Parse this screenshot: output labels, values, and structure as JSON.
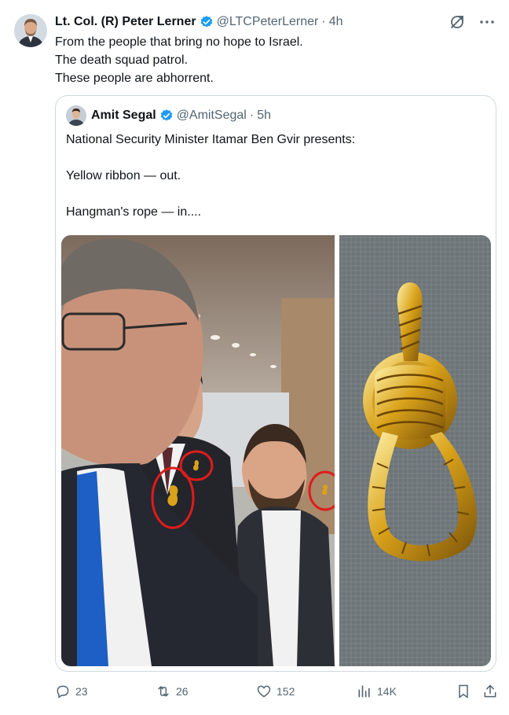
{
  "tweet": {
    "author_name": "Lt. Col. (R) Peter Lerner",
    "handle": "@LTCPeterLerner",
    "separator": "·",
    "time": "4h",
    "lines": [
      "From the people that bring no hope to Israel.",
      "The death squad patrol.",
      "These people are abhorrent."
    ]
  },
  "quote": {
    "author_name": "Amit Segal",
    "handle": "@AmitSegal",
    "separator": "·",
    "time": "5h",
    "paragraphs": [
      "National Security Minister Itamar Ben Gvir presents:",
      "Yellow ribbon — out.",
      "Hangman's rope — in...."
    ]
  },
  "actions": {
    "replies": "23",
    "reposts": "26",
    "likes": "152",
    "views": "14K"
  },
  "colors": {
    "verified": "#1d9bf0",
    "secondary_text": "#536471",
    "border": "#cfd9de",
    "tie_blue": "#1d5fc4",
    "pin_gold": "#d9a21a",
    "circle_red": "#e01b1b"
  },
  "icons": [
    "verified-badge-icon",
    "grok-icon",
    "more-icon",
    "reply-icon",
    "repost-icon",
    "like-icon",
    "views-icon",
    "bookmark-icon",
    "share-icon"
  ]
}
